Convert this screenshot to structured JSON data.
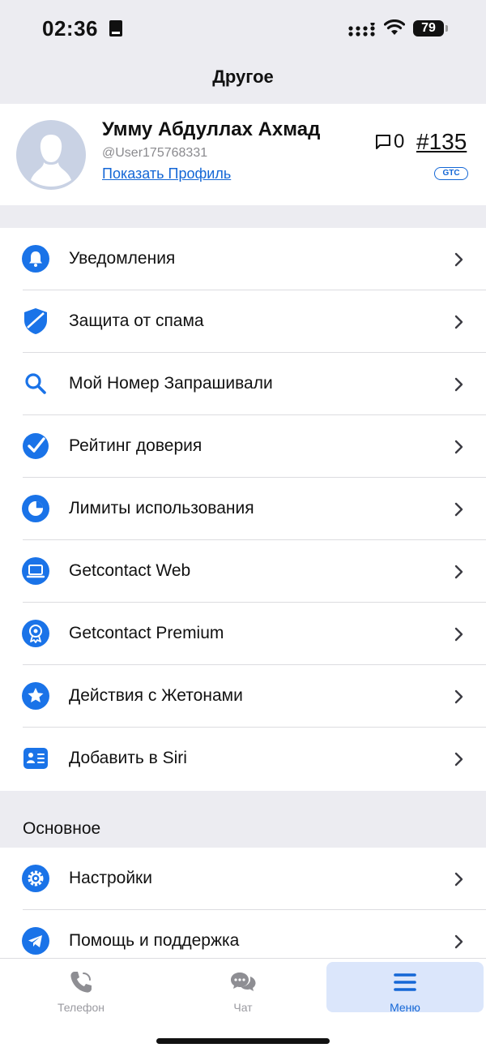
{
  "status_bar": {
    "time": "02:36",
    "battery": "79"
  },
  "nav": {
    "title": "Другое"
  },
  "profile": {
    "name": "Умму Абдуллах Ахмад",
    "handle": "@User175768331",
    "show_profile": "Показать Профиль",
    "comment_count": "0",
    "rank": "#135",
    "badge": "GTC"
  },
  "menu": [
    {
      "label": "Уведомления",
      "icon": "bell-icon"
    },
    {
      "label": "Защита от спама",
      "icon": "shield-icon"
    },
    {
      "label": "Мой Номер Запрашивали",
      "icon": "search-icon"
    },
    {
      "label": "Рейтинг доверия",
      "icon": "check-badge-icon"
    },
    {
      "label": "Лимиты использования",
      "icon": "pie-chart-icon"
    },
    {
      "label": "Getcontact Web",
      "icon": "laptop-icon"
    },
    {
      "label": "Getcontact Premium",
      "icon": "award-icon"
    },
    {
      "label": "Действия с Жетонами",
      "icon": "star-icon"
    },
    {
      "label": "Добавить в Siri",
      "icon": "contact-card-icon"
    }
  ],
  "section": {
    "title": "Основное"
  },
  "menu_main": [
    {
      "label": "Настройки",
      "icon": "gear-icon"
    },
    {
      "label": "Помощь и поддержка",
      "icon": "telegram-icon"
    }
  ],
  "tabs": [
    {
      "label": "Телефон",
      "icon": "phone-icon"
    },
    {
      "label": "Чат",
      "icon": "chat-icon"
    },
    {
      "label": "Меню",
      "icon": "menu-icon",
      "active": true
    }
  ],
  "colors": {
    "accent": "#1467d6",
    "background": "#ececf1"
  }
}
